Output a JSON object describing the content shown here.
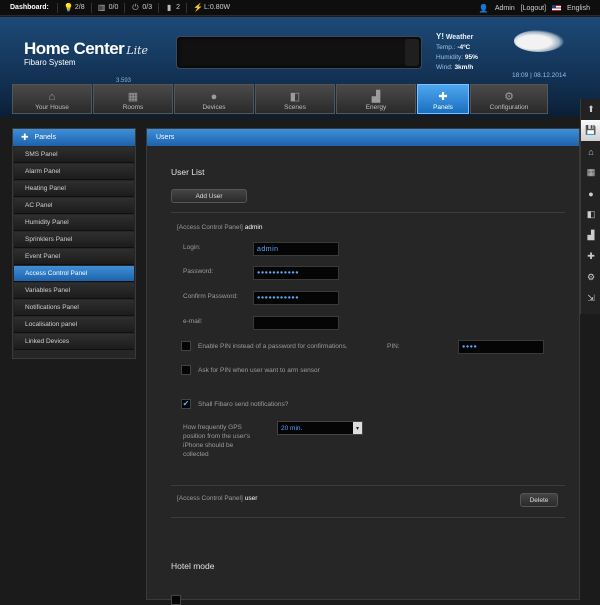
{
  "topbar": {
    "dashboard_label": "Dashboard:",
    "stats": [
      {
        "icon": "bulb-icon",
        "glyph": "💡",
        "value": "2/8"
      },
      {
        "icon": "blind-icon",
        "glyph": "▥",
        "value": "0/0"
      },
      {
        "icon": "plug-icon",
        "glyph": "⏻",
        "value": "0/3"
      },
      {
        "icon": "door-sensor-icon",
        "glyph": "▮",
        "value": "2"
      },
      {
        "icon": "power-icon",
        "glyph": "⚡",
        "value": "L:0.80W"
      }
    ],
    "user_label": "Admin",
    "logout_label": "[Logout]",
    "language": "English"
  },
  "header": {
    "brand_title": "Home Center",
    "brand_lite": "Lite",
    "brand_sub": "Fibaro System",
    "version": "3.593",
    "weather": {
      "title": "Weather",
      "temp_label": "Temp.:",
      "temp_value": "-4ºC",
      "humidity_label": "Humidity:",
      "humidity_value": "95%",
      "wind_label": "Wind:",
      "wind_value": "3km/h"
    },
    "datetime": "18:09 | 08.12.2014"
  },
  "nav": {
    "tabs": [
      {
        "label": "Your House",
        "icon": "house-icon",
        "glyph": "⌂"
      },
      {
        "label": "Rooms",
        "icon": "rooms-icon",
        "glyph": "▦"
      },
      {
        "label": "Devices",
        "icon": "bulb-icon",
        "glyph": "●"
      },
      {
        "label": "Scenes",
        "icon": "scenes-icon",
        "glyph": "◧"
      },
      {
        "label": "Energy",
        "icon": "energy-icon",
        "glyph": "▟"
      },
      {
        "label": "Panels",
        "icon": "puzzle-icon",
        "glyph": "✚"
      },
      {
        "label": "Configuration",
        "icon": "gears-icon",
        "glyph": "⚙"
      }
    ],
    "active_index": 5
  },
  "sidebar": {
    "title": "Panels",
    "items": [
      "SMS Panel",
      "Alarm Panel",
      "Heating Panel",
      "AC Panel",
      "Humidity Panel",
      "Sprinklers Panel",
      "Event Panel",
      "Access Control Panel",
      "Variables Panel",
      "Notifications Panel",
      "Localisation panel",
      "Linked Devices"
    ],
    "active_index": 7
  },
  "main": {
    "header": "Users",
    "user_list_title": "User List",
    "add_user_label": "Add User",
    "admin_block": {
      "prefix": "[Access Control Panel]",
      "name": "admin",
      "login_label": "Login:",
      "login_value": "admin",
      "password_label": "Password:",
      "password_value": "●●●●●●●●●●●",
      "confirm_label": "Confirm Password:",
      "confirm_value": "●●●●●●●●●●●",
      "email_label": "e-mail:",
      "email_value": "",
      "pin_option_label": "Enable PIN instead of a password for confirmations.",
      "pin_label": "PIN:",
      "pin_value": "●●●●",
      "arm_pin_label": "Ask for PIN when user want to arm sensor",
      "notify_label": "Shall Fibaro send notifications?",
      "gps_label_1": "How frequently GPS",
      "gps_label_2": "position from the user's",
      "gps_label_3": "iPhone should be",
      "gps_label_4": "collected",
      "gps_value": "20 min."
    },
    "user_block": {
      "prefix": "[Access Control Panel]",
      "name": "user",
      "delete_label": "Delete"
    },
    "hotel_title": "Hotel mode"
  },
  "rightbar": {
    "items": [
      {
        "icon": "arrow-up-icon",
        "glyph": "⬆"
      },
      {
        "icon": "save-icon",
        "glyph": "💾"
      },
      {
        "icon": "house-icon",
        "glyph": "⌂"
      },
      {
        "icon": "rooms-icon",
        "glyph": "▦"
      },
      {
        "icon": "bulb-icon",
        "glyph": "●"
      },
      {
        "icon": "scenes-icon",
        "glyph": "◧"
      },
      {
        "icon": "energy-icon",
        "glyph": "▟"
      },
      {
        "icon": "puzzle-icon",
        "glyph": "✚"
      },
      {
        "icon": "gears-icon",
        "glyph": "⚙"
      },
      {
        "icon": "logout-icon",
        "glyph": "⇲"
      }
    ],
    "active_index": 1
  }
}
